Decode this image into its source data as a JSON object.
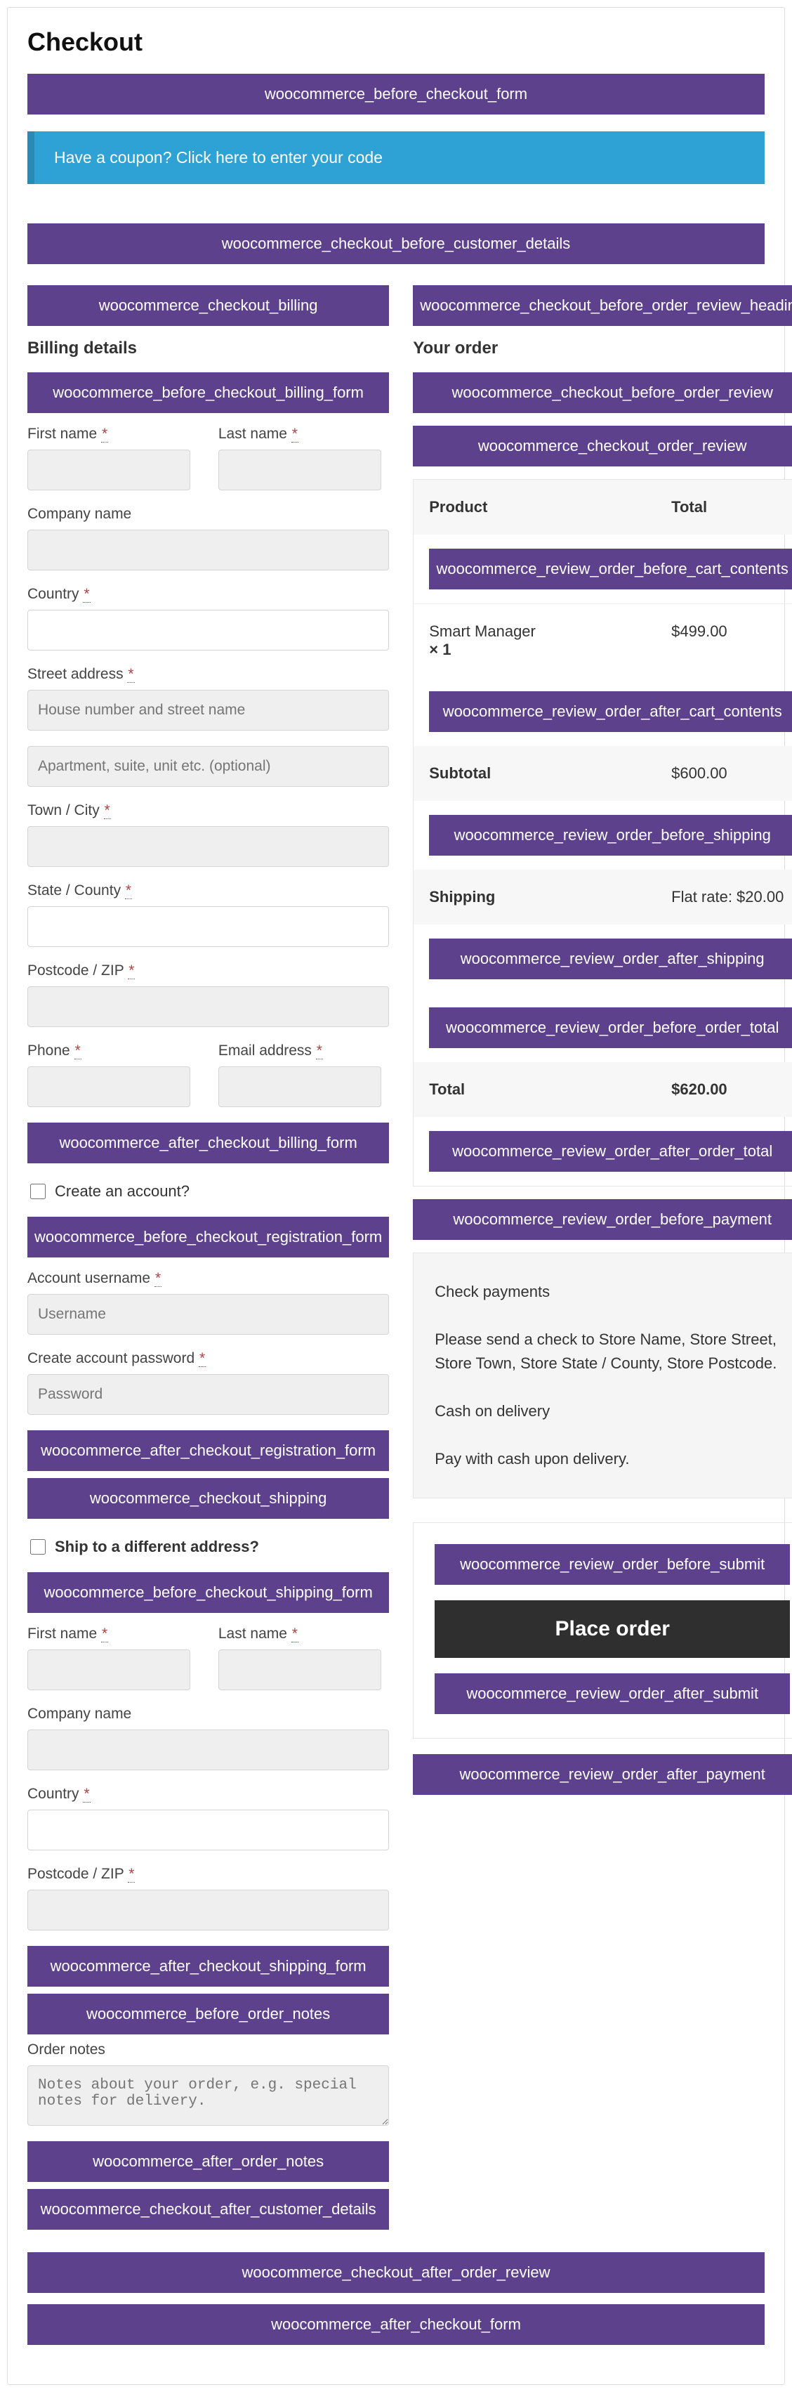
{
  "page": {
    "title": "Checkout"
  },
  "coupon": {
    "text": "Have a coupon? Click here to enter your code"
  },
  "hooks": {
    "before_checkout_form": "woocommerce_before_checkout_form",
    "checkout_before_customer_details": "woocommerce_checkout_before_customer_details",
    "checkout_billing": "woocommerce_checkout_billing",
    "before_checkout_billing_form": "woocommerce_before_checkout_billing_form",
    "after_checkout_billing_form": "woocommerce_after_checkout_billing_form",
    "before_checkout_registration_form": "woocommerce_before_checkout_registration_form",
    "after_checkout_registration_form": "woocommerce_after_checkout_registration_form",
    "checkout_shipping": "woocommerce_checkout_shipping",
    "before_checkout_shipping_form": "woocommerce_before_checkout_shipping_form",
    "after_checkout_shipping_form": "woocommerce_after_checkout_shipping_form",
    "before_order_notes": "woocommerce_before_order_notes",
    "after_order_notes": "woocommerce_after_order_notes",
    "checkout_after_customer_details": "woocommerce_checkout_after_customer_details",
    "checkout_before_order_review_heading": "woocommerce_checkout_before_order_review_heading",
    "checkout_before_order_review": "woocommerce_checkout_before_order_review",
    "checkout_order_review": "woocommerce_checkout_order_review",
    "review_order_before_cart_contents": "woocommerce_review_order_before_cart_contents",
    "review_order_after_cart_contents": "woocommerce_review_order_after_cart_contents",
    "review_order_before_shipping": "woocommerce_review_order_before_shipping",
    "review_order_after_shipping": "woocommerce_review_order_after_shipping",
    "review_order_before_order_total": "woocommerce_review_order_before_order_total",
    "review_order_after_order_total": "woocommerce_review_order_after_order_total",
    "review_order_before_payment": "woocommerce_review_order_before_payment",
    "review_order_before_submit": "woocommerce_review_order_before_submit",
    "review_order_after_submit": "woocommerce_review_order_after_submit",
    "review_order_after_payment": "woocommerce_review_order_after_payment",
    "checkout_after_order_review": "woocommerce_checkout_after_order_review",
    "after_checkout_form": "woocommerce_after_checkout_form"
  },
  "billing": {
    "heading": "Billing details",
    "first_name": "First name",
    "last_name": "Last name",
    "company": "Company name",
    "country": "Country",
    "street": "Street address",
    "street_ph1": "House number and street name",
    "street_ph2": "Apartment, suite, unit etc. (optional)",
    "town": "Town / City",
    "state": "State / County",
    "postcode": "Postcode / ZIP",
    "phone": "Phone",
    "email": "Email address",
    "create_account": "Create an account?",
    "username_label": "Account username",
    "username_ph": "Username",
    "password_label": "Create account password",
    "password_ph": "Password"
  },
  "shipping": {
    "ship_diff": "Ship to a different address?",
    "first_name": "First name",
    "last_name": "Last name",
    "company": "Company name",
    "country": "Country",
    "postcode": "Postcode / ZIP",
    "notes_label": "Order notes",
    "notes_ph": "Notes about your order, e.g. special notes for delivery."
  },
  "order": {
    "heading": "Your order",
    "product_h": "Product",
    "total_h": "Total",
    "item_name": "Smart Manager",
    "item_qty": "× 1",
    "item_total": "$499.00",
    "subtotal_label": "Subtotal",
    "subtotal_value": "$600.00",
    "shipping_label": "Shipping",
    "shipping_value": "Flat rate: $20.00",
    "total_label": "Total",
    "total_value": "$620.00"
  },
  "payments": {
    "check_title": "Check payments",
    "check_desc": "Please send a check to Store Name, Store Street, Store Town, Store State / County, Store Postcode.",
    "cod_title": "Cash on delivery",
    "cod_desc": "Pay with cash upon delivery."
  },
  "submit": {
    "place_order": "Place order"
  },
  "required": "*"
}
